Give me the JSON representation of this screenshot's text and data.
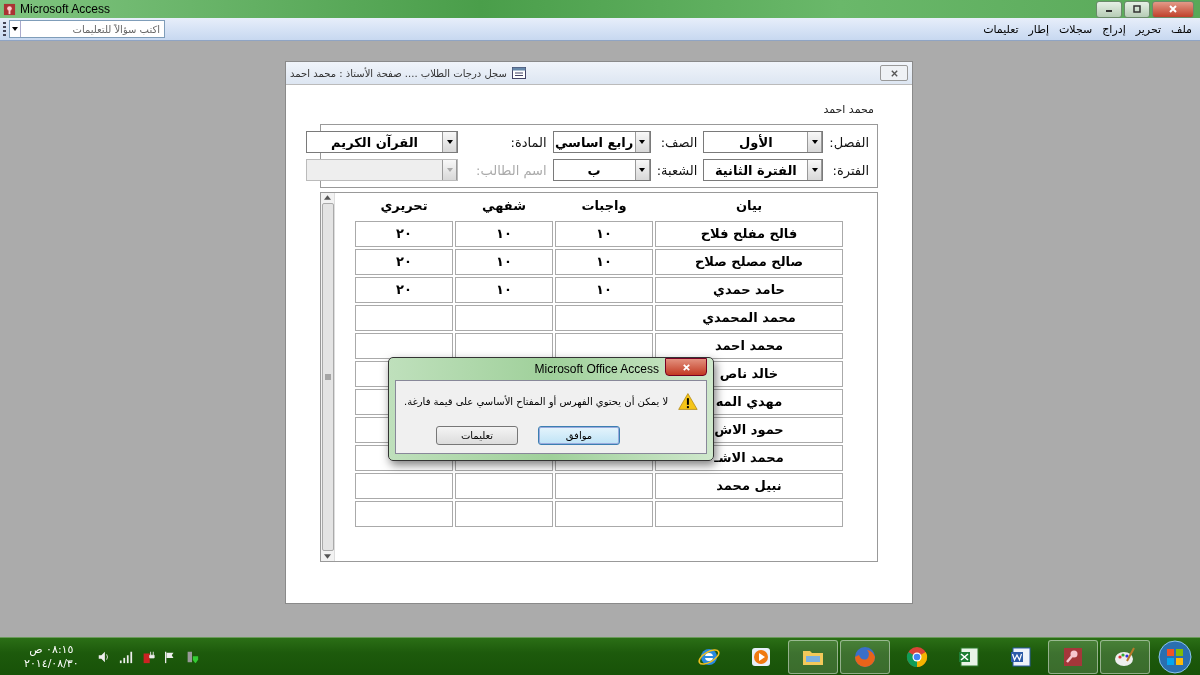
{
  "window": {
    "title": "Microsoft Access"
  },
  "menu": [
    {
      "label": "ملف"
    },
    {
      "label": "تحرير"
    },
    {
      "label": "إدراج"
    },
    {
      "label": "سجلات"
    },
    {
      "label": "إطار"
    },
    {
      "label": "تعليمات"
    }
  ],
  "help_box": {
    "placeholder": "اكتب سؤالاً للتعليمات"
  },
  "form": {
    "title": "سجل درجات الطلاب .... صفحة الأستاذ : محمد احمد",
    "user_label": "محمد احمد",
    "fields": [
      {
        "label": "الفصل:",
        "value": "الأول",
        "disabled": false
      },
      {
        "label": "الصف:",
        "value": "رابع اساسي",
        "disabled": false
      },
      {
        "label": "المادة:",
        "value": "القرآن الكريم",
        "disabled": false
      },
      {
        "label": "الفترة:",
        "value": "الفترة الثانية",
        "disabled": false
      },
      {
        "label": "الشعبة:",
        "value": "ب",
        "disabled": false
      },
      {
        "label": "اسم الطالب:",
        "disabled": true
      }
    ],
    "grid": {
      "columns": [
        "بيان",
        "واجبات",
        "شفهي",
        "تحريري"
      ],
      "rows": [
        [
          "فالح مفلح فلاح",
          "١٠",
          "١٠",
          "٢٠"
        ],
        [
          "صالح مصلح صلاح",
          "١٠",
          "١٠",
          "٢٠"
        ],
        [
          "حامد حمدي",
          "١٠",
          "١٠",
          "٢٠"
        ],
        [
          "محمد المحمدي",
          "",
          "",
          ""
        ],
        [
          "محمد احمد",
          "",
          "",
          ""
        ],
        [
          "خالد ناص",
          "",
          "",
          ""
        ],
        [
          "مهدي المه",
          "",
          "",
          ""
        ],
        [
          "حمود الاش",
          "",
          "",
          ""
        ],
        [
          "محمد الاشـ",
          "",
          "",
          ""
        ],
        [
          "نبيل محمد",
          "",
          "",
          ""
        ],
        [
          "",
          "",
          "",
          ""
        ]
      ]
    }
  },
  "dialog": {
    "title": "Microsoft Office Access",
    "message": "لا يمكن أن يحتوي الفهرس أو المفتاح الأساسي على قيمة فارغة.",
    "buttons": [
      {
        "label": "موافق",
        "default": true
      },
      {
        "label": "تعليمات",
        "default": false
      }
    ]
  },
  "taskbar": {
    "clock_time": "٠٨:١٥ ص",
    "clock_date": "٢٠١٤/٠٨/٣٠",
    "apps": [
      {
        "kind": "ie",
        "active": false
      },
      {
        "kind": "media",
        "active": false
      },
      {
        "kind": "explorer",
        "active": true
      },
      {
        "kind": "firefox",
        "active": true
      },
      {
        "kind": "chrome",
        "active": false
      },
      {
        "kind": "excel",
        "active": false
      },
      {
        "kind": "word",
        "active": false
      },
      {
        "kind": "access",
        "active": true
      },
      {
        "kind": "paint",
        "active": true
      }
    ]
  }
}
